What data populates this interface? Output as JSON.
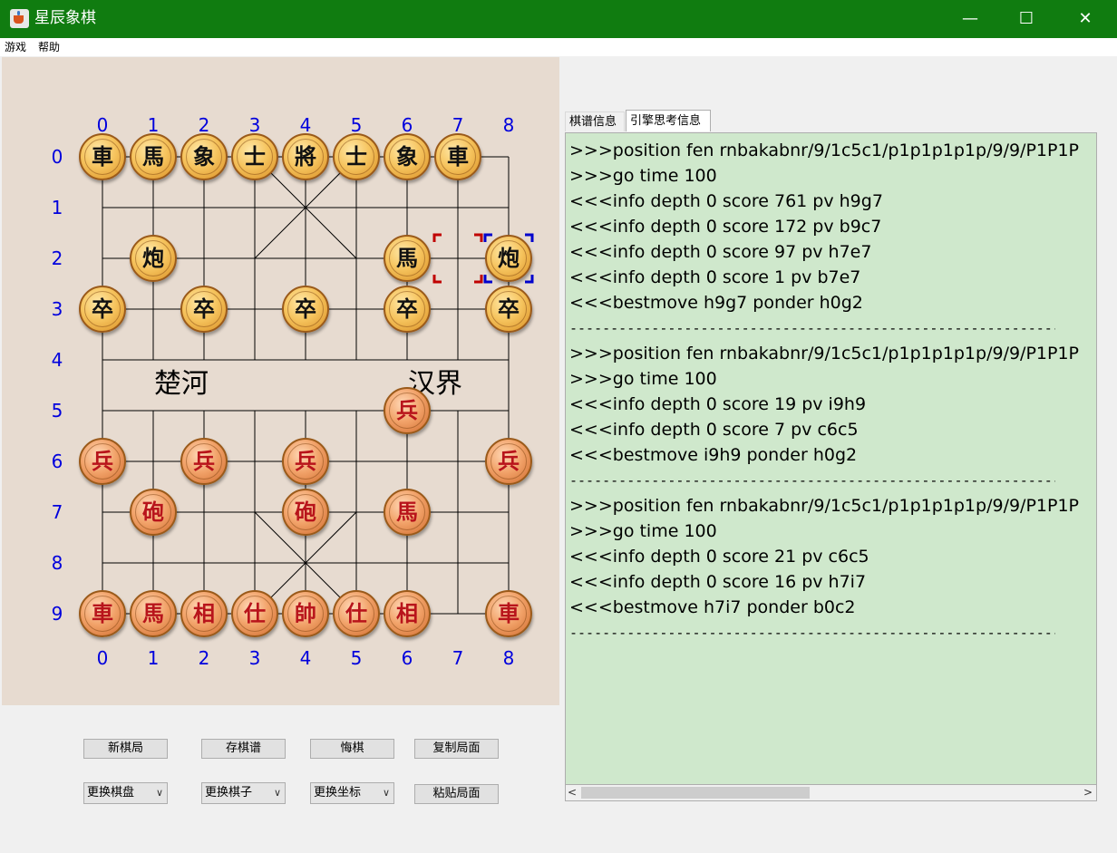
{
  "window": {
    "title": "星辰象棋",
    "icon": "java-cup-icon",
    "controls": {
      "minimize": "—",
      "maximize": "☐",
      "close": "✕"
    },
    "titlebar_color": "#107c10"
  },
  "menu": [
    "游戏",
    "帮助"
  ],
  "board": {
    "columns": [
      "0",
      "1",
      "2",
      "3",
      "4",
      "5",
      "6",
      "7",
      "8"
    ],
    "rows": [
      "0",
      "1",
      "2",
      "3",
      "4",
      "5",
      "6",
      "7",
      "8",
      "9"
    ],
    "river_left": "楚河",
    "river_right": "汉界",
    "coord_color": "#0000dd",
    "black_pieces": [
      {
        "label": "車",
        "col": 0,
        "row": 0
      },
      {
        "label": "馬",
        "col": 1,
        "row": 0
      },
      {
        "label": "象",
        "col": 2,
        "row": 0
      },
      {
        "label": "士",
        "col": 3,
        "row": 0
      },
      {
        "label": "將",
        "col": 4,
        "row": 0
      },
      {
        "label": "士",
        "col": 5,
        "row": 0
      },
      {
        "label": "象",
        "col": 6,
        "row": 0
      },
      {
        "label": "車",
        "col": 7,
        "row": 0
      },
      {
        "label": "炮",
        "col": 1,
        "row": 2
      },
      {
        "label": "馬",
        "col": 6,
        "row": 2
      },
      {
        "label": "炮",
        "col": 8,
        "row": 2
      },
      {
        "label": "卒",
        "col": 0,
        "row": 3
      },
      {
        "label": "卒",
        "col": 2,
        "row": 3
      },
      {
        "label": "卒",
        "col": 4,
        "row": 3
      },
      {
        "label": "卒",
        "col": 6,
        "row": 3
      },
      {
        "label": "卒",
        "col": 8,
        "row": 3
      }
    ],
    "red_pieces": [
      {
        "label": "兵",
        "col": 6,
        "row": 5
      },
      {
        "label": "兵",
        "col": 0,
        "row": 6
      },
      {
        "label": "兵",
        "col": 2,
        "row": 6
      },
      {
        "label": "兵",
        "col": 4,
        "row": 6
      },
      {
        "label": "兵",
        "col": 8,
        "row": 6
      },
      {
        "label": "砲",
        "col": 1,
        "row": 7
      },
      {
        "label": "砲",
        "col": 4,
        "row": 7
      },
      {
        "label": "馬",
        "col": 6,
        "row": 7
      },
      {
        "label": "車",
        "col": 0,
        "row": 9
      },
      {
        "label": "馬",
        "col": 1,
        "row": 9
      },
      {
        "label": "相",
        "col": 2,
        "row": 9
      },
      {
        "label": "仕",
        "col": 3,
        "row": 9
      },
      {
        "label": "帥",
        "col": 4,
        "row": 9
      },
      {
        "label": "仕",
        "col": 5,
        "row": 9
      },
      {
        "label": "相",
        "col": 6,
        "row": 9
      },
      {
        "label": "車",
        "col": 8,
        "row": 9
      }
    ],
    "last_move": {
      "from": {
        "col": 7,
        "row": 2
      },
      "to": {
        "col": 8,
        "row": 2
      },
      "from_color": "#c00000",
      "to_color": "#0000cc"
    }
  },
  "buttons": {
    "new_game": "新棋局",
    "save_record": "存棋谱",
    "undo": "悔棋",
    "copy_position": "复制局面",
    "paste_position": "粘贴局面"
  },
  "combos": {
    "change_board": "更换棋盘",
    "change_pieces": "更换棋子",
    "change_coords": "更换坐标"
  },
  "tabs": {
    "record_info": "棋谱信息",
    "engine_info": "引擎思考信息"
  },
  "log": [
    ">>>position fen rnbakabnr/9/1c5c1/p1p1p1p1p/9/9/P1P1P",
    ">>>go time 100",
    "<<<info depth 0 score 761 pv h9g7",
    "<<<info depth 0 score 172 pv b9c7",
    "<<<info depth 0 score 97 pv h7e7",
    "<<<info depth 0 score 1 pv b7e7",
    "<<<bestmove h9g7 ponder h0g2",
    "------------------------------------------------------------",
    ">>>position fen rnbakabnr/9/1c5c1/p1p1p1p1p/9/9/P1P1P",
    ">>>go time 100",
    "<<<info depth 0 score 19 pv i9h9",
    "<<<info depth 0 score 7 pv c6c5",
    "<<<bestmove i9h9 ponder h0g2",
    "------------------------------------------------------------",
    ">>>position fen rnbakabnr/9/1c5c1/p1p1p1p1p/9/9/P1P1P",
    ">>>go time 100",
    "<<<info depth 0 score 21 pv c6c5",
    "<<<info depth 0 score 16 pv h7i7",
    "<<<bestmove h7i7 ponder b0c2",
    "------------------------------------------------------------"
  ],
  "log_bg": "#cfe8cc",
  "hscroll": {
    "left": "<",
    "right": ">"
  }
}
